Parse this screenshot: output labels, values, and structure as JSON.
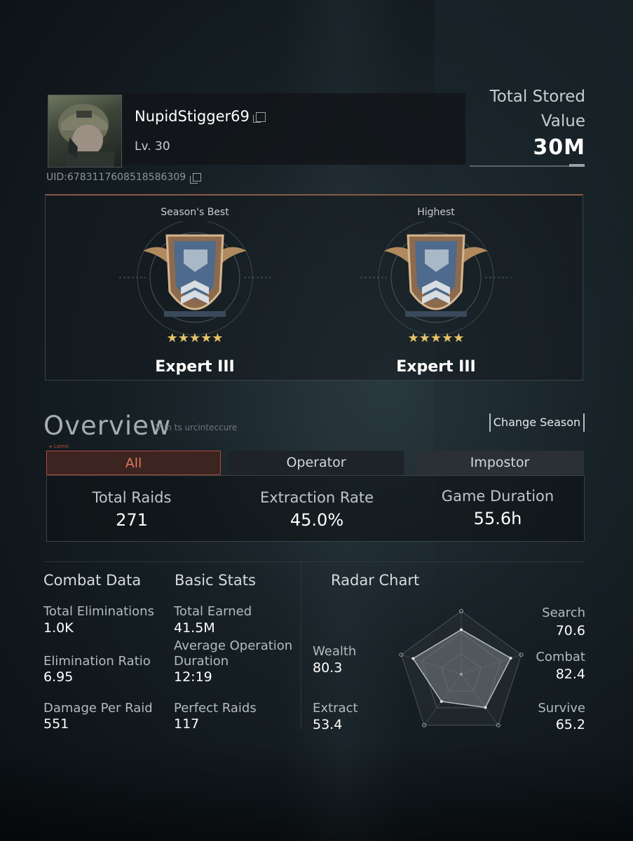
{
  "profile": {
    "username": "NupidStigger69",
    "level": "Lv. 30",
    "uid": "UID:6783117608518586309",
    "copy_icon": "copy-icon"
  },
  "stored": {
    "label": "Total Stored Value",
    "value": "30M"
  },
  "ranks": [
    {
      "caption": "Season's Best",
      "stars": "★★★★★",
      "name": "Expert III"
    },
    {
      "caption": "Highest",
      "stars": "★★★★★",
      "name": "Expert III"
    }
  ],
  "overview": {
    "title": "Overview",
    "subtitle": "V in ts urcinteccure",
    "change_season": "Change Season",
    "tabs": [
      "All",
      "Operator",
      "Impostor"
    ],
    "tab_badge": "▸ Latest",
    "active_tab": "All",
    "summary": [
      {
        "label": "Total Raids",
        "value": "271"
      },
      {
        "label": "Extraction Rate",
        "value": "45.0%"
      },
      {
        "label": "Game Duration",
        "value": "55.6h"
      }
    ]
  },
  "combat": {
    "title": "Combat Data",
    "stats": [
      {
        "label": "Total Eliminations",
        "value": "1.0K"
      },
      {
        "label": "Elimination Ratio",
        "value": "6.95"
      },
      {
        "label": "Damage Per Raid",
        "value": "551"
      }
    ]
  },
  "basic": {
    "title": "Basic Stats",
    "stats": [
      {
        "label": "Total Earned",
        "value": "41.5M"
      },
      {
        "label": "Average Operation Duration",
        "value": "12:19"
      },
      {
        "label": "Perfect Raids",
        "value": "117"
      }
    ]
  },
  "chart_data": {
    "type": "radar",
    "title": "Radar Chart",
    "axes": [
      "Search",
      "Combat",
      "Survive",
      "Extract",
      "Wealth"
    ],
    "values": [
      70.6,
      82.4,
      65.2,
      53.4,
      80.3
    ],
    "max": 100,
    "labels": {
      "search": "Search",
      "combat": "Combat",
      "survive": "Survive",
      "extract": "Extract",
      "wealth": "Wealth"
    },
    "display": {
      "search": "70.6",
      "combat": "82.4",
      "survive": "65.2",
      "extract": "53.4",
      "wealth": "80.3"
    }
  },
  "colors": {
    "accent": "#b0493a",
    "tab_active_text": "#e2765e",
    "star": "#e6c36a"
  }
}
